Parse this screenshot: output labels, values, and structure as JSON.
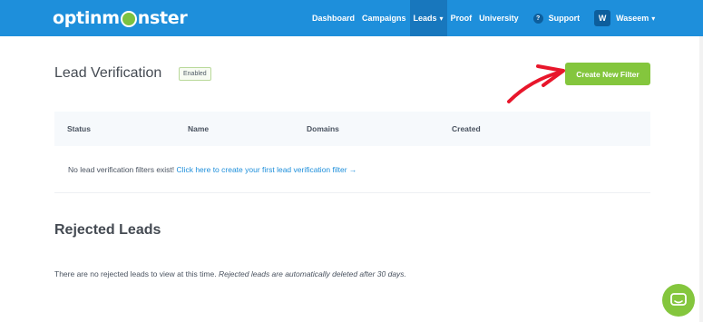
{
  "brand": {
    "logo_left": "optinm",
    "logo_right": "nster"
  },
  "nav": {
    "items": [
      {
        "label": "Dashboard"
      },
      {
        "label": "Campaigns"
      },
      {
        "label": "Leads"
      },
      {
        "label": "Proof"
      },
      {
        "label": "University"
      },
      {
        "label": "Support"
      }
    ],
    "user": {
      "initial": "W",
      "name": "Waseem"
    }
  },
  "lead_verification": {
    "title": "Lead Verification",
    "status_badge": "Enabled",
    "create_button": "Create New Filter",
    "table_headers": [
      "Status",
      "Name",
      "Domains",
      "Created"
    ],
    "empty_text": "No lead verification filters exist!",
    "empty_link": "Click here to create your first lead verification filter →"
  },
  "rejected_leads": {
    "title": "Rejected Leads",
    "note": "There are no rejected leads to view at this time.",
    "note_italic": "Rejected leads are automatically deleted after 30 days."
  },
  "colors": {
    "nav_bg": "#1e8fdb",
    "accent_green": "#84c63d",
    "annotation_red": "#e8162b",
    "link_blue": "#1e8fdb"
  },
  "icons": {
    "help": "question-circle-icon",
    "chat": "chat-bubble-icon",
    "annotation": "red-arrow-annotation"
  }
}
